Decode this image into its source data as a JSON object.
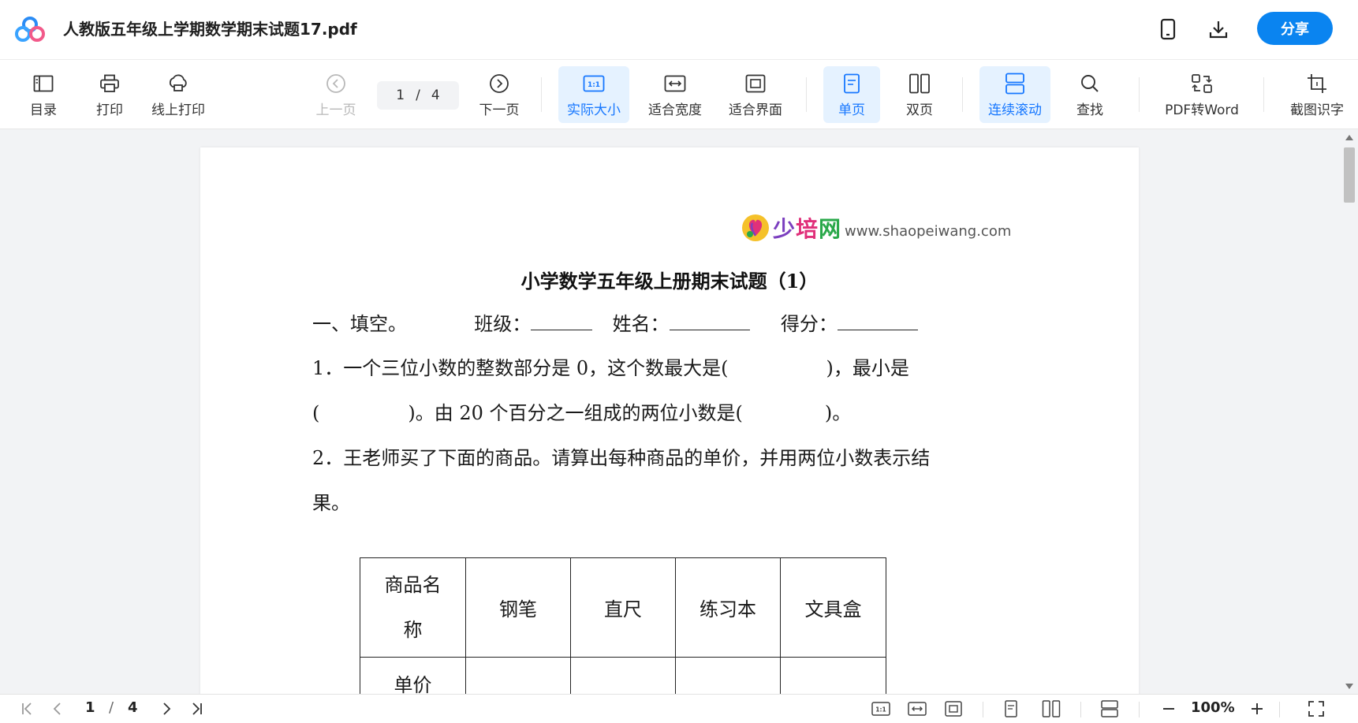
{
  "titlebar": {
    "doc_title": "人教版五年级上学期数学期末试题17.pdf",
    "share_label": "分享"
  },
  "toolbar": {
    "toc": "目录",
    "print": "打印",
    "online_print": "线上打印",
    "prev_page": "上一页",
    "current_page": "1",
    "page_sep": "/",
    "total_pages": "4",
    "next_page": "下一页",
    "actual_size": "实际大小",
    "fit_width": "适合宽度",
    "fit_screen": "适合界面",
    "single_page": "单页",
    "double_page": "双页",
    "continuous_scroll": "连续滚动",
    "find": "查找",
    "pdf_to_word": "PDF转Word",
    "screenshot_ocr": "截图识字",
    "actual_size_icon_text": "1:1"
  },
  "document": {
    "brand_cn_1": "少",
    "brand_cn_2": "培",
    "brand_cn_3": "网",
    "brand_url": "www.shaopeiwang.com",
    "exam_title": "小学数学五年级上册期末试题（1）",
    "section1_head": "一、填空。",
    "class_label": "班级：",
    "name_label": "姓名：",
    "score_label": "得分：",
    "q1_part1": "1．一个三位小数的整数部分是  0，这个数最大是(",
    "q1_part2": ")，最小是",
    "q1_line2_a": "(",
    "q1_line2_b": ")。由 20 个百分之一组成的两位小数是(",
    "q1_line2_c": ")。",
    "q2_line1": "2．王老师买了下面的商品。请算出每种商品的单价，并用两位小数表示结",
    "q2_line2": "果。",
    "table_header": [
      "商品名称",
      "钢笔",
      "直尺",
      "练习本",
      "文具盒"
    ],
    "table_header_first_l1": "商品名",
    "table_header_first_l2": "称",
    "table_row2_first": "单价"
  },
  "bottombar": {
    "current_page": "1",
    "page_sep": "/",
    "total_pages": "4",
    "zoom": "100%",
    "actual_size_icon_text": "1:1"
  },
  "colors": {
    "accent": "#1677ff",
    "share_bg": "#0a84f0",
    "active_bg": "#e5f2ff"
  }
}
